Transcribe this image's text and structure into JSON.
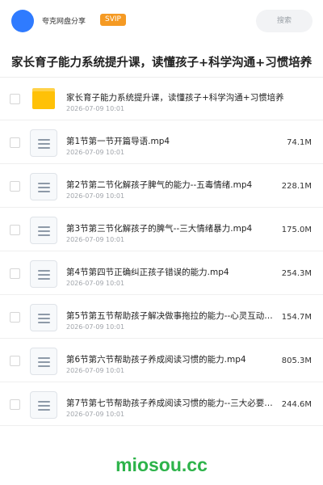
{
  "header": {
    "app_name": "夸克网盘分享",
    "badge": "SVIP",
    "search_placeholder": "搜索",
    "avatar_color": "#2f7bff",
    "badge_color": "#f59a23"
  },
  "folder_title": "家长育子能力系统提升课，读懂孩子+科学沟通+习惯培养",
  "files": [
    {
      "type": "folder",
      "icon": "folder-icon",
      "name": "家长育子能力系统提升课，读懂孩子+科学沟通+习惯培养",
      "date": "2026-07-09 10:01",
      "size": ""
    },
    {
      "type": "file",
      "icon": "file-icon",
      "name": "第1节第一节开篇导语.mp4",
      "date": "2026-07-09 10:01",
      "size": "74.1M"
    },
    {
      "type": "file",
      "icon": "file-icon",
      "name": "第2节第二节化解孩子脾气的能力--五毒情绪.mp4",
      "date": "2026-07-09 10:01",
      "size": "228.1M"
    },
    {
      "type": "file",
      "icon": "file-icon",
      "name": "第3节第三节化解孩子的脾气--三大情绪暴力.mp4",
      "date": "2026-07-09 10:01",
      "size": "175.0M"
    },
    {
      "type": "file",
      "icon": "file-icon",
      "name": "第4节第四节正确纠正孩子错误的能力.mp4",
      "date": "2026-07-09 10:01",
      "size": "254.3M"
    },
    {
      "type": "file",
      "icon": "file-icon",
      "name": "第5节第五节帮助孩子解决做事拖拉的能力--心灵互动…",
      "date": "2026-07-09 10:01",
      "size": "154.7M"
    },
    {
      "type": "file",
      "icon": "file-icon",
      "name": "第6节第六节帮助孩子养成阅读习惯的能力.mp4",
      "date": "2026-07-09 10:01",
      "size": "805.3M"
    },
    {
      "type": "file",
      "icon": "file-icon",
      "name": "第7节第七节帮助孩子养成阅读习惯的能力--三大必要…",
      "date": "2026-07-09 10:01",
      "size": "244.6M"
    }
  ],
  "watermark": "miosou.cc",
  "colors": {
    "folder": "#ffc107",
    "watermark": "#2db34a"
  }
}
